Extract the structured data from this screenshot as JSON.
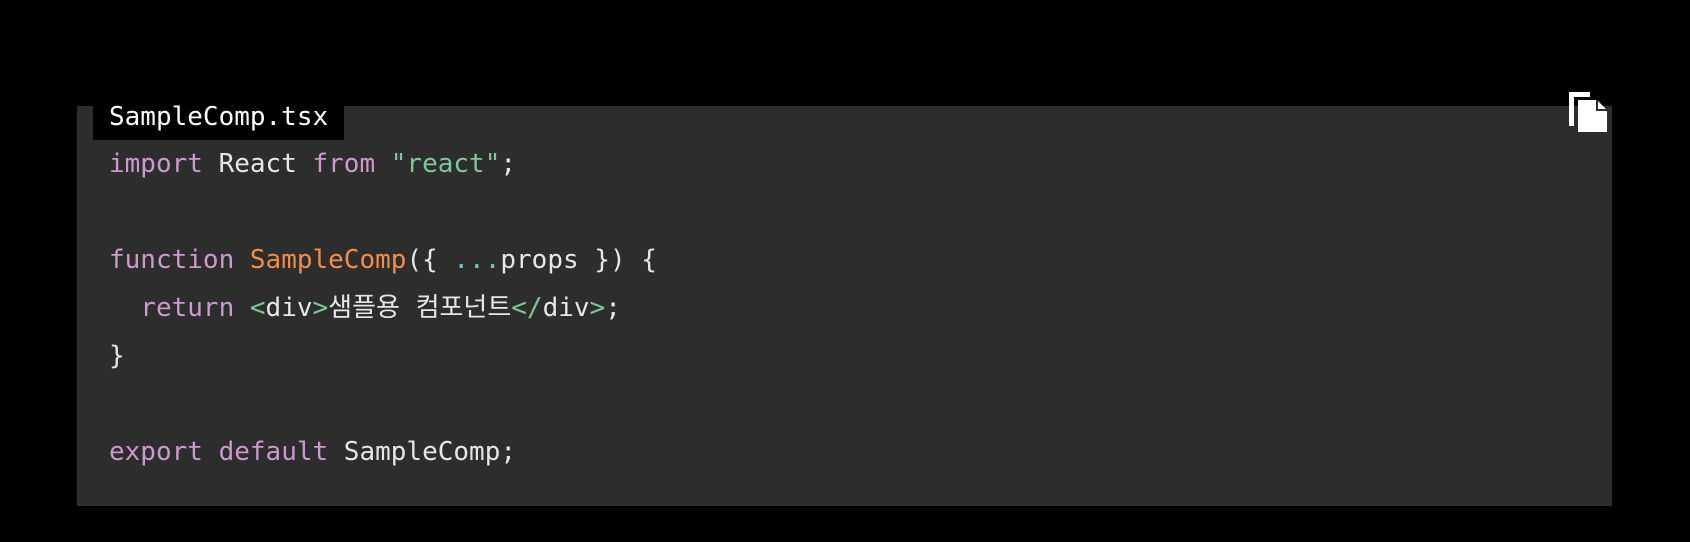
{
  "file_tab": {
    "filename": "SampleComp.tsx"
  },
  "copy_button": {
    "icon": "copy-icon"
  },
  "code": {
    "line1": {
      "kw1": "import",
      "sp1": " React ",
      "kw2": "from",
      "sp2": " ",
      "str": "\"react\"",
      "end": ";"
    },
    "line3": {
      "kw": "function",
      "sp": " ",
      "fn": "SampleComp",
      "p1": "({ ",
      "spread": "...",
      "p2": "props }) {"
    },
    "line4": {
      "indent": "  ",
      "kw": "return",
      "sp": " ",
      "t1": "<",
      "tag1": "div",
      "t2": ">",
      "text": "샘플용 컴포넌트",
      "t3": "</",
      "tag2": "div",
      "t4": ">",
      "end": ";"
    },
    "line5": {
      "brace": "}"
    },
    "line7": {
      "kw1": "export",
      "sp1": " ",
      "kw2": "default",
      "sp2": " SampleComp",
      "end": ";"
    }
  },
  "colors": {
    "background": "#000000",
    "code_background": "#2d2d2d",
    "keyword": "#cc99cd",
    "string": "#7ec699",
    "function": "#f08d49",
    "plain": "#e6e6e6"
  }
}
